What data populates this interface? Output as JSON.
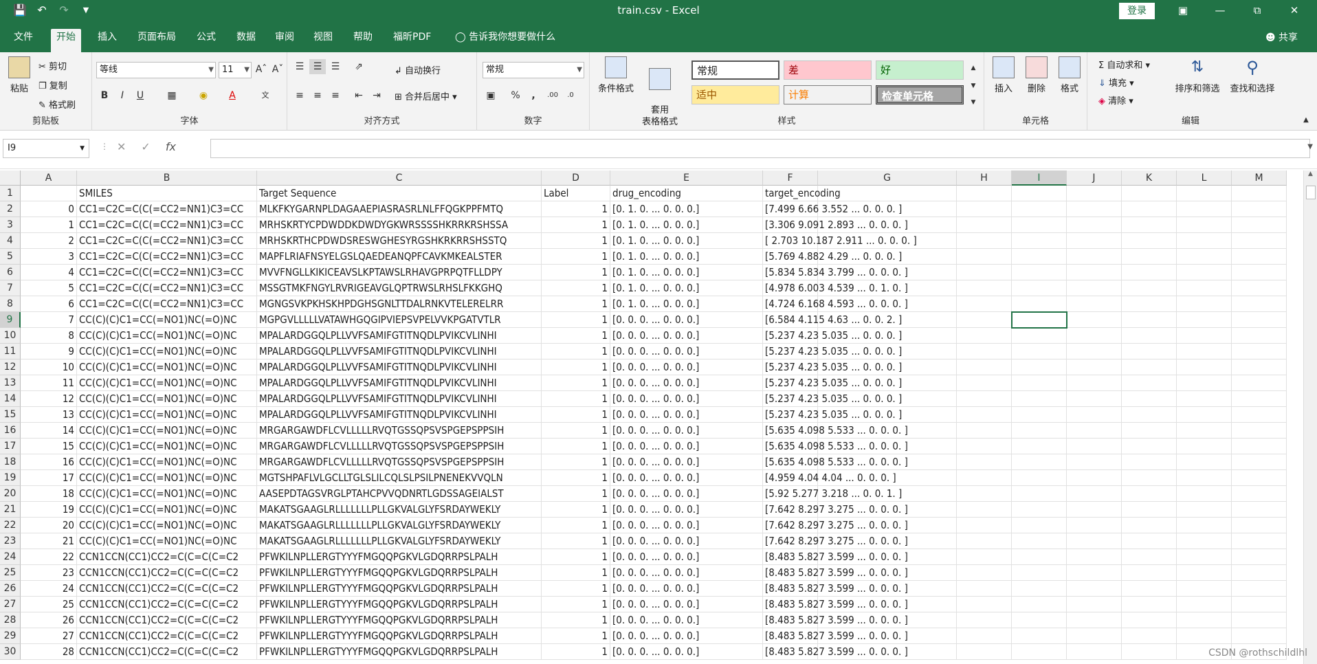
{
  "titlebar": {
    "title": "train.csv  -  Excel",
    "login": "登录",
    "icons": [
      "save-icon",
      "undo-icon",
      "redo-icon",
      "customize-icon"
    ]
  },
  "menu": {
    "tabs": [
      "文件",
      "开始",
      "插入",
      "页面布局",
      "公式",
      "数据",
      "审阅",
      "视图",
      "帮助",
      "福昕PDF",
      "告诉我你想要做什么"
    ],
    "active": "开始",
    "share": "共享"
  },
  "ribbon": {
    "clipboard": {
      "paste": "粘贴",
      "cut": "剪切",
      "copy": "复制",
      "format_painter": "格式刷",
      "label": "剪贴板"
    },
    "font": {
      "name": "等线",
      "size": "11",
      "label": "字体",
      "bold": "B",
      "italic": "I",
      "underline": "U"
    },
    "align": {
      "wrap": "自动换行",
      "merge": "合并后居中",
      "label": "对齐方式"
    },
    "number": {
      "format": "常规",
      "percent": "%",
      "comma": ",",
      "label": "数字"
    },
    "styles": {
      "cond_format": "条件格式",
      "table_format": "套用\n表格格式",
      "cells": [
        "常规",
        "差",
        "好",
        "适中",
        "计算",
        "检查单元格"
      ],
      "label": "样式"
    },
    "cells": {
      "insert": "插入",
      "delete": "删除",
      "format": "格式",
      "label": "单元格"
    },
    "editing": {
      "autosum": "自动求和",
      "fill": "填充",
      "clear": "清除",
      "sort": "排序和筛选",
      "find": "查找和选择",
      "label": "编辑"
    }
  },
  "formula_bar": {
    "name_box": "I9",
    "content": "",
    "fx": "fx"
  },
  "sheet": {
    "columns": [
      "A",
      "B",
      "C",
      "D",
      "E",
      "F",
      "G",
      "H",
      "I",
      "J",
      "K",
      "L",
      "M"
    ],
    "selected_col": "I",
    "selected_row": 9,
    "header_row": [
      "",
      "SMILES",
      "Target Sequence",
      "Label",
      "drug_encoding",
      "target_encoding"
    ],
    "rows": [
      [
        "0",
        "CC1=C2C=C(C(=CC2=NN1)C3=CC",
        "MLKFKYGARNPLDAGAAEPIASRASRLNLFFQGKPPFMTQ",
        "1",
        "[0. 1. 0. ... 0. 0. 0.]",
        "[7.499 6.66  3.552 ... 0.     0.     0.   ]"
      ],
      [
        "1",
        "CC1=C2C=C(C(=CC2=NN1)C3=CC",
        "MRHSKRTYCPDWDDKDWDYGKWRSSSSHKRRKRSHSSA",
        "1",
        "[0. 1. 0. ... 0. 0. 0.]",
        "[3.306 9.091 2.893 ... 0.     0.     0.   ]"
      ],
      [
        "2",
        "CC1=C2C=C(C(=CC2=NN1)C3=CC",
        "MRHSKRTHCPDWDSRESWGHESYRGSHKRKRRSHSSTQ",
        "1",
        "[0. 1. 0. ... 0. 0. 0.]",
        "[ 2.703 10.187  2.911 ...  0.     0.     0.   ]"
      ],
      [
        "3",
        "CC1=C2C=C(C(=CC2=NN1)C3=CC",
        "MAPFLRIAFNSYELGSLQAEDEANQPFCAVKMKEALSTER",
        "1",
        "[0. 1. 0. ... 0. 0. 0.]",
        "[5.769 4.882 4.29  ... 0.     0.     0.   ]"
      ],
      [
        "4",
        "CC1=C2C=C(C(=CC2=NN1)C3=CC",
        "MVVFNGLLKIKICEAVSLKPTAWSLRHAVGPRPQTFLLDPY",
        "1",
        "[0. 1. 0. ... 0. 0. 0.]",
        "[5.834 5.834 3.799 ... 0.     0.     0.   ]"
      ],
      [
        "5",
        "CC1=C2C=C(C(=CC2=NN1)C3=CC",
        "MSSGTMKFNGYLRVRIGEAVGLQPTRWSLRHSLFKKGHQ",
        "1",
        "[0. 1. 0. ... 0. 0. 0.]",
        "[4.978 6.003 4.539 ... 0.     1.     0.   ]"
      ],
      [
        "6",
        "CC1=C2C=C(C(=CC2=NN1)C3=CC",
        "MGNGSVKPKHSKHPDGHSGNLTTDALRNKVTELERELRR",
        "1",
        "[0. 1. 0. ... 0. 0. 0.]",
        "[4.724 6.168 4.593 ... 0.     0.     0.   ]"
      ],
      [
        "7",
        "CC(C)(C)C1=CC(=NO1)NC(=O)NC",
        "MGPGVLLLLLVATAWHGQGIPVIEPSVPELVVKPGATVTLR",
        "1",
        "[0. 0. 0. ... 0. 0. 0.]",
        "[6.584 4.115 4.63  ... 0.     0.     2.   ]"
      ],
      [
        "8",
        "CC(C)(C)C1=CC(=NO1)NC(=O)NC",
        "MPALARDGGQLPLLVVFSAMIFGTITNQDLPVIKCVLINHI",
        "1",
        "[0. 0. 0. ... 0. 0. 0.]",
        "[5.237 4.23  5.035 ... 0.     0.     0.   ]"
      ],
      [
        "9",
        "CC(C)(C)C1=CC(=NO1)NC(=O)NC",
        "MPALARDGGQLPLLVVFSAMIFGTITNQDLPVIKCVLINHI",
        "1",
        "[0. 0. 0. ... 0. 0. 0.]",
        "[5.237 4.23  5.035 ... 0.     0.     0.   ]"
      ],
      [
        "10",
        "CC(C)(C)C1=CC(=NO1)NC(=O)NC",
        "MPALARDGGQLPLLVVFSAMIFGTITNQDLPVIKCVLINHI",
        "1",
        "[0. 0. 0. ... 0. 0. 0.]",
        "[5.237 4.23  5.035 ... 0.     0.     0.   ]"
      ],
      [
        "11",
        "CC(C)(C)C1=CC(=NO1)NC(=O)NC",
        "MPALARDGGQLPLLVVFSAMIFGTITNQDLPVIKCVLINHI",
        "1",
        "[0. 0. 0. ... 0. 0. 0.]",
        "[5.237 4.23  5.035 ... 0.     0.     0.   ]"
      ],
      [
        "12",
        "CC(C)(C)C1=CC(=NO1)NC(=O)NC",
        "MPALARDGGQLPLLVVFSAMIFGTITNQDLPVIKCVLINHI",
        "1",
        "[0. 0. 0. ... 0. 0. 0.]",
        "[5.237 4.23  5.035 ... 0.     0.     0.   ]"
      ],
      [
        "13",
        "CC(C)(C)C1=CC(=NO1)NC(=O)NC",
        "MPALARDGGQLPLLVVFSAMIFGTITNQDLPVIKCVLINHI",
        "1",
        "[0. 0. 0. ... 0. 0. 0.]",
        "[5.237 4.23  5.035 ... 0.     0.     0.   ]"
      ],
      [
        "14",
        "CC(C)(C)C1=CC(=NO1)NC(=O)NC",
        "MRGARGAWDFLCVLLLLLRVQTGSSQPSVSPGEPSPPSIH",
        "1",
        "[0. 0. 0. ... 0. 0. 0.]",
        "[5.635 4.098 5.533 ... 0.     0.     0.   ]"
      ],
      [
        "15",
        "CC(C)(C)C1=CC(=NO1)NC(=O)NC",
        "MRGARGAWDFLCVLLLLLRVQTGSSQPSVSPGEPSPPSIH",
        "1",
        "[0. 0. 0. ... 0. 0. 0.]",
        "[5.635 4.098 5.533 ... 0.     0.     0.   ]"
      ],
      [
        "16",
        "CC(C)(C)C1=CC(=NO1)NC(=O)NC",
        "MRGARGAWDFLCVLLLLLRVQTGSSQPSVSPGEPSPPSIH",
        "1",
        "[0. 0. 0. ... 0. 0. 0.]",
        "[5.635 4.098 5.533 ... 0.     0.     0.   ]"
      ],
      [
        "17",
        "CC(C)(C)C1=CC(=NO1)NC(=O)NC",
        "MGTSHPAFLVLGCLLTGLSLILCQLSLPSILPNENEKVVQLN",
        "1",
        "[0. 0. 0. ... 0. 0. 0.]",
        "[4.959 4.04  4.04  ... 0.     0.     0.   ]"
      ],
      [
        "18",
        "CC(C)(C)C1=CC(=NO1)NC(=O)NC",
        "AASEPDTAGSVRGLPTAHCPVVQDNRTLGDSSAGEIALST",
        "1",
        "[0. 0. 0. ... 0. 0. 0.]",
        "[5.92  5.277 3.218 ... 0.     0.     1.   ]"
      ],
      [
        "19",
        "CC(C)(C)C1=CC(=NO1)NC(=O)NC",
        "MAKATSGAAGLRLLLLLLLPLLGKVALGLYFSRDAYWEKLY",
        "1",
        "[0. 0. 0. ... 0. 0. 0.]",
        "[7.642 8.297 3.275 ... 0.     0.     0.   ]"
      ],
      [
        "20",
        "CC(C)(C)C1=CC(=NO1)NC(=O)NC",
        "MAKATSGAAGLRLLLLLLLPLLGKVALGLYFSRDAYWEKLY",
        "1",
        "[0. 0. 0. ... 0. 0. 0.]",
        "[7.642 8.297 3.275 ... 0.     0.     0.   ]"
      ],
      [
        "21",
        "CC(C)(C)C1=CC(=NO1)NC(=O)NC",
        "MAKATSGAAGLRLLLLLLLPLLGKVALGLYFSRDAYWEKLY",
        "1",
        "[0. 0. 0. ... 0. 0. 0.]",
        "[7.642 8.297 3.275 ... 0.     0.     0.   ]"
      ],
      [
        "22",
        "CCN1CCN(CC1)CC2=C(C=C(C=C2",
        "PFWKILNPLLERGTYYYFMGQQPGKVLGDQRRPSLPALH",
        "1",
        "[0. 0. 0. ... 0. 0. 0.]",
        "[8.483 5.827 3.599 ... 0.     0.     0.   ]"
      ],
      [
        "23",
        "CCN1CCN(CC1)CC2=C(C=C(C=C2",
        "PFWKILNPLLERGTYYYFMGQQPGKVLGDQRRPSLPALH",
        "1",
        "[0. 0. 0. ... 0. 0. 0.]",
        "[8.483 5.827 3.599 ... 0.     0.     0.   ]"
      ],
      [
        "24",
        "CCN1CCN(CC1)CC2=C(C=C(C=C2",
        "PFWKILNPLLERGTYYYFMGQQPGKVLGDQRRPSLPALH",
        "1",
        "[0. 0. 0. ... 0. 0. 0.]",
        "[8.483 5.827 3.599 ... 0.     0.     0.   ]"
      ],
      [
        "25",
        "CCN1CCN(CC1)CC2=C(C=C(C=C2",
        "PFWKILNPLLERGTYYYFMGQQPGKVLGDQRRPSLPALH",
        "1",
        "[0. 0. 0. ... 0. 0. 0.]",
        "[8.483 5.827 3.599 ... 0.     0.     0.   ]"
      ],
      [
        "26",
        "CCN1CCN(CC1)CC2=C(C=C(C=C2",
        "PFWKILNPLLERGTYYYFMGQQPGKVLGDQRRPSLPALH",
        "1",
        "[0. 0. 0. ... 0. 0. 0.]",
        "[8.483 5.827 3.599 ... 0.     0.     0.   ]"
      ],
      [
        "27",
        "CCN1CCN(CC1)CC2=C(C=C(C=C2",
        "PFWKILNPLLERGTYYYFMGQQPGKVLGDQRRPSLPALH",
        "1",
        "[0. 0. 0. ... 0. 0. 0.]",
        "[8.483 5.827 3.599 ... 0.     0.     0.   ]"
      ],
      [
        "28",
        "CCN1CCN(CC1)CC2=C(C=C(C=C2",
        "PFWKILNPLLERGTYYYFMGQQPGKVLGDQRRPSLPALH",
        "1",
        "[0. 0. 0. ... 0. 0. 0.]",
        "[8.483 5.827 3.599 ... 0.     0.     0.   ]"
      ]
    ]
  },
  "watermark": "CSDN @rothschildlhl",
  "colors": {
    "accent": "#217346",
    "bad": "#ffc7ce",
    "good": "#c6efce",
    "neutral": "#ffeb9c"
  }
}
